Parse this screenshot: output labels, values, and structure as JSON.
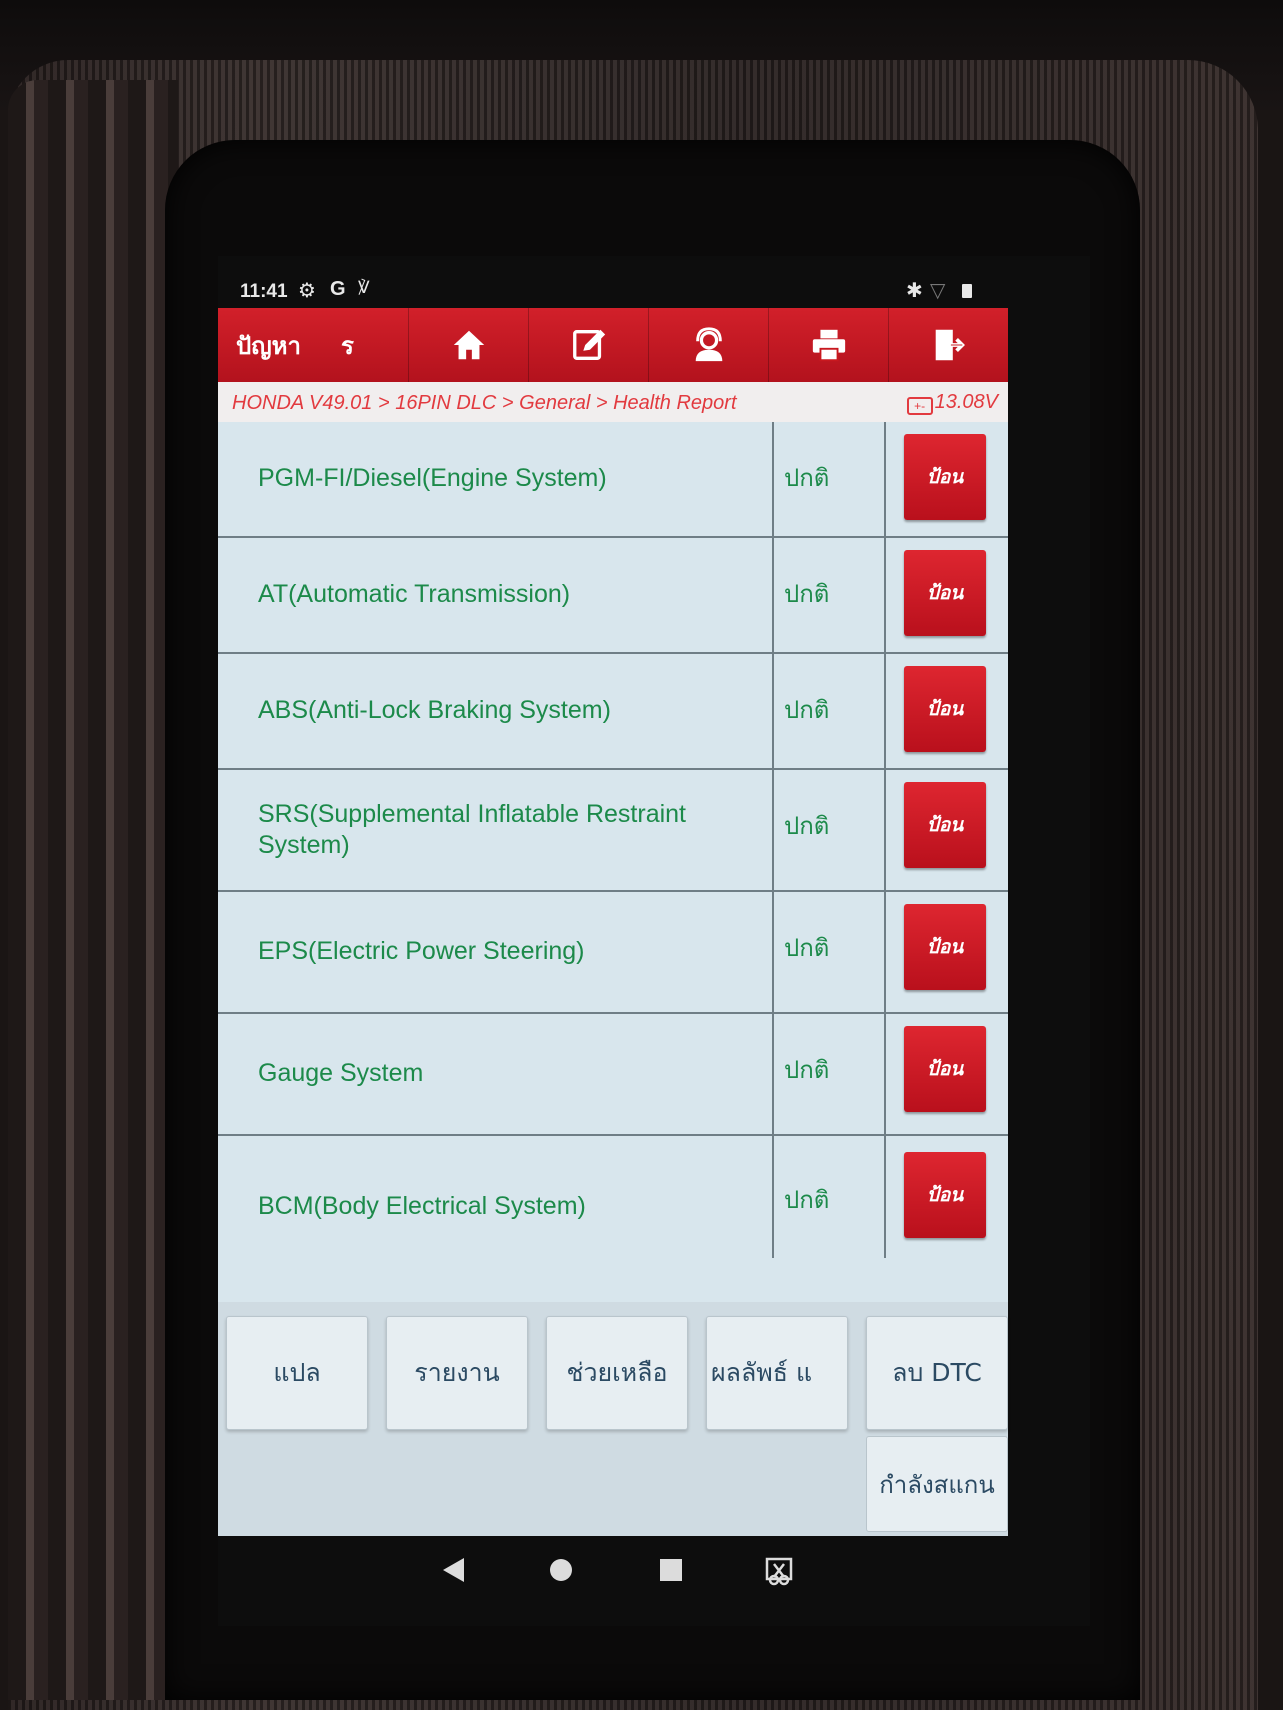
{
  "status_bar": {
    "time": "11:41",
    "left_icons": [
      "settings-icon",
      "google-icon",
      "stethoscope-icon"
    ],
    "right_icons": [
      "bluetooth-icon",
      "wifi-icon",
      "battery-icon"
    ]
  },
  "toolbar": {
    "title": "ปัญหา",
    "title_suffix": "ร",
    "buttons": [
      "home-icon",
      "edit-icon",
      "support-icon",
      "print-icon",
      "exit-icon"
    ]
  },
  "breadcrumb": {
    "path": "HONDA V49.01 > 16PIN DLC > General > Health Report",
    "voltage": "13.08V"
  },
  "systems": [
    {
      "name": "PGM-FI/Diesel(Engine System)",
      "status": "ปกติ",
      "action": "ป้อน"
    },
    {
      "name": "AT(Automatic Transmission)",
      "status": "ปกติ",
      "action": "ป้อน"
    },
    {
      "name": "ABS(Anti-Lock Braking System)",
      "status": "ปกติ",
      "action": "ป้อน"
    },
    {
      "name": "SRS(Supplemental Inflatable Restraint System)",
      "status": "ปกติ",
      "action": "ป้อน"
    },
    {
      "name": "EPS(Electric Power Steering)",
      "status": "ปกติ",
      "action": "ป้อน"
    },
    {
      "name": "Gauge System",
      "status": "ปกติ",
      "action": "ป้อน"
    },
    {
      "name": "BCM(Body Electrical System)",
      "status": "ปกติ",
      "action": "ป้อน"
    }
  ],
  "function_buttons": [
    "แปล",
    "รายงาน",
    "ช่วยเหลือ",
    "ผลลัพธ์ แ",
    "ลบ DTC"
  ],
  "scan_button": "กำลังสแกน",
  "colors": {
    "toolbar_red": "#c8181f",
    "text_green": "#1c8a4a",
    "breadcrumb_red": "#e23a3f",
    "list_bg": "#d8e6ed"
  }
}
